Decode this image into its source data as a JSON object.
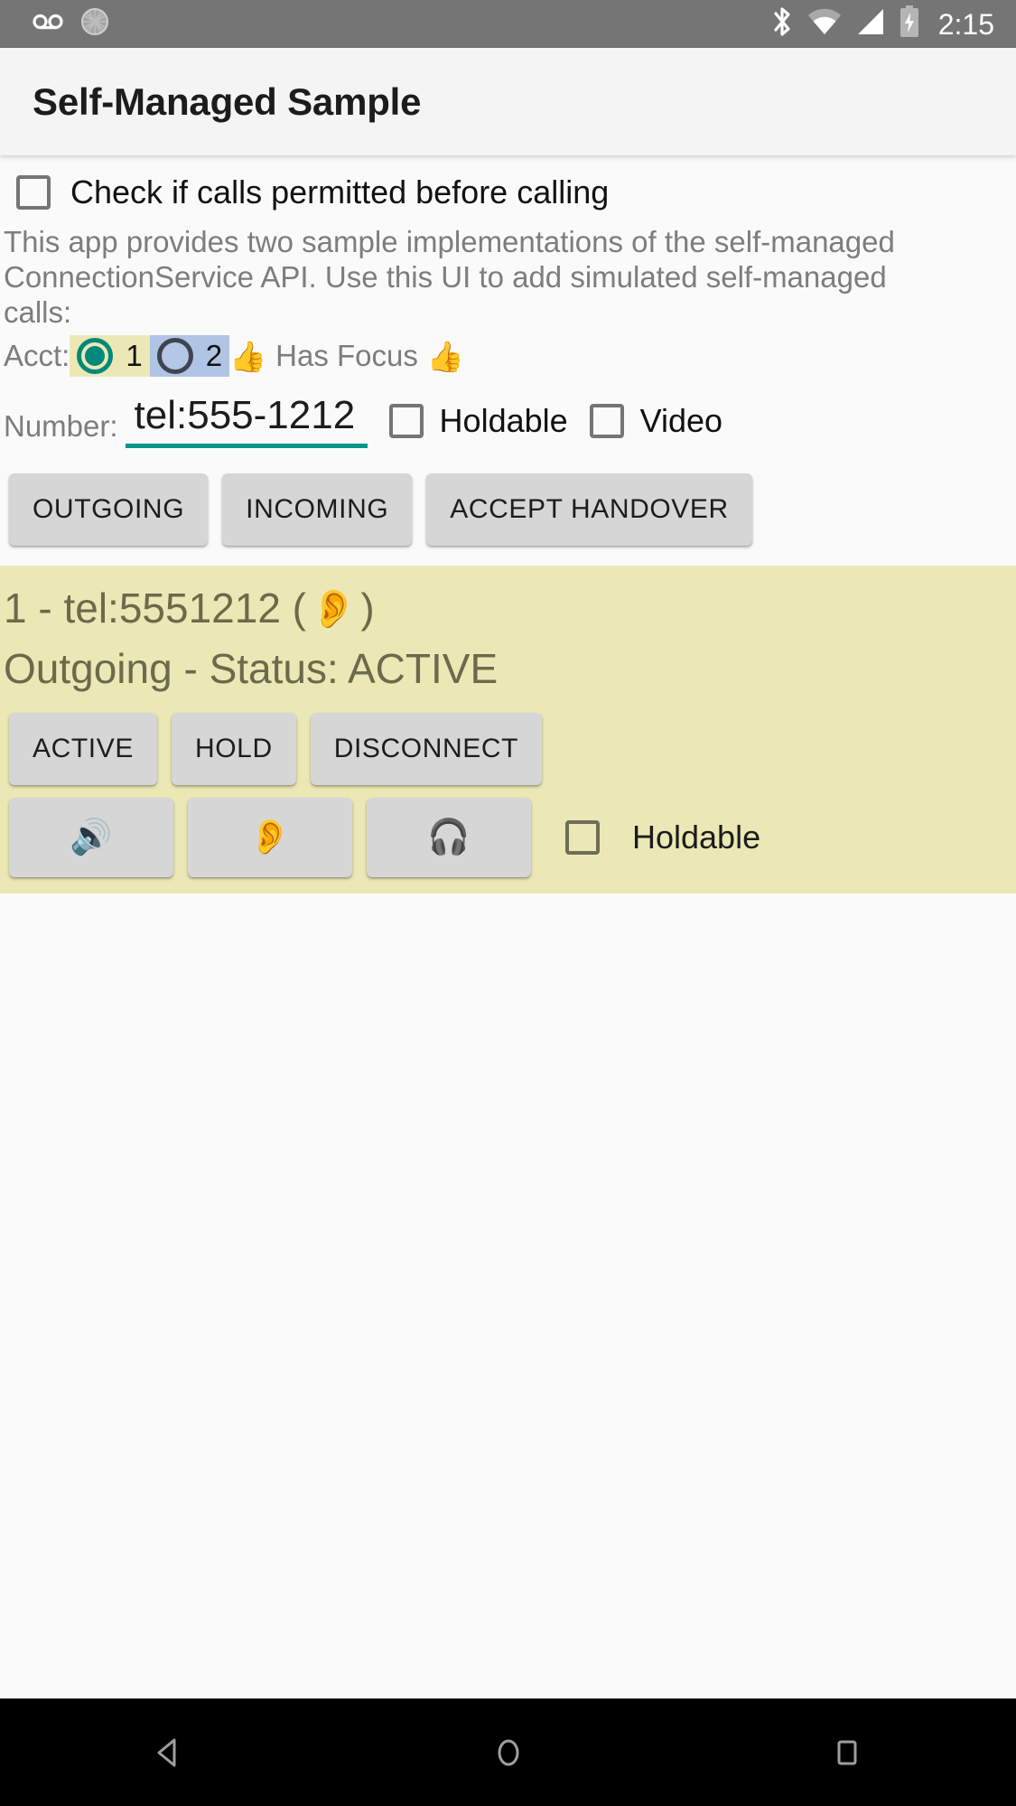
{
  "status_bar": {
    "icons_left": [
      "voicemail-icon",
      "sync-spinner-icon"
    ],
    "icons_right": [
      "bluetooth-icon",
      "wifi-icon",
      "cell-signal-icon",
      "battery-charging-icon"
    ],
    "time": "2:15",
    "background_color": "#757575"
  },
  "app_bar": {
    "title": "Self-Managed Sample",
    "background_color": "#f4f4f4"
  },
  "permit": {
    "label": "Check if calls permitted before calling",
    "checked": false
  },
  "description": "This app provides two sample implementations of the self-managed ConnectionService API.  Use this UI to add simulated self-managed calls:",
  "account": {
    "label": "Acct:",
    "options": [
      {
        "value": "1",
        "selected": true,
        "highlight_color": "#ece8b5"
      },
      {
        "value": "2",
        "selected": false,
        "highlight_color": "#b0c4e4"
      }
    ],
    "focus_emoji_left": "👍",
    "focus_text": "Has Focus",
    "focus_emoji_right": "👍",
    "selected_color": "#00897b"
  },
  "number": {
    "label": "Number:",
    "value": "tel:555-1212",
    "placeholder": "tel:555-1212",
    "underline_color": "#009688",
    "holdable": {
      "label": "Holdable",
      "checked": false
    },
    "video": {
      "label": "Video",
      "checked": false
    }
  },
  "actions": {
    "outgoing": "OUTGOING",
    "incoming": "INCOMING",
    "accept_handover": "ACCEPT HANDOVER"
  },
  "call": {
    "panel_color": "#ece8b5",
    "header_prefix": "1 - tel:5551212 (",
    "header_audio_emoji": "👂",
    "header_suffix": ")",
    "status_line": "Outgoing - Status: ACTIVE",
    "buttons": {
      "active": "ACTIVE",
      "hold": "HOLD",
      "disconnect": "DISCONNECT"
    },
    "audio_routes": [
      {
        "name": "speaker",
        "emoji": "🔊"
      },
      {
        "name": "earpiece",
        "emoji": "👂"
      },
      {
        "name": "headset",
        "emoji": "🎧"
      }
    ],
    "holdable": {
      "label": "Holdable",
      "checked": false
    }
  },
  "nav_bar": {
    "back": "back-icon",
    "home": "home-icon",
    "recents": "recents-icon",
    "background_color": "#000000"
  }
}
